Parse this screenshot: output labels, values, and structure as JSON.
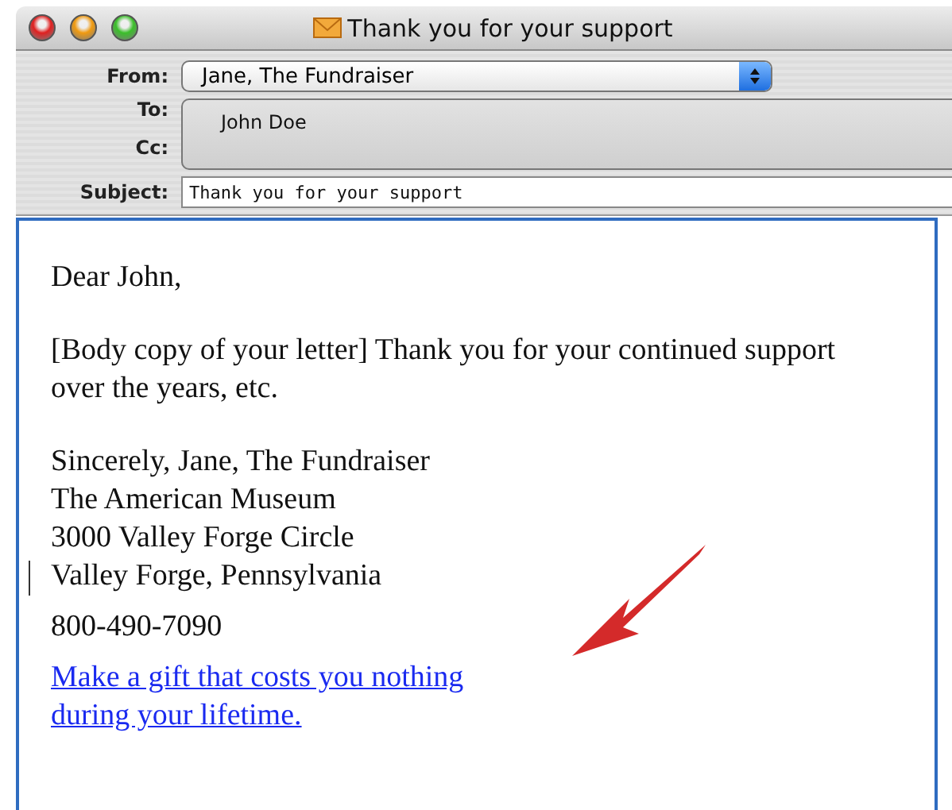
{
  "window": {
    "title": "Thank you for your support"
  },
  "header": {
    "from_label": "From:",
    "from_value": "Jane, The Fundraiser",
    "to_label": "To:",
    "to_recipients": [
      "John Doe"
    ],
    "cc_label": "Cc:",
    "subject_label": "Subject:",
    "subject_value": "Thank you for your support"
  },
  "body": {
    "greeting": "Dear John,",
    "paragraph": "[Body copy of your letter]  Thank you for your continued support over the years, etc.",
    "signature": [
      "Sincerely, Jane, The Fundraiser",
      "The American Museum",
      "3000 Valley Forge Circle",
      "Valley Forge, Pennsylvania"
    ],
    "phone": "800-490-7090",
    "link_lines": [
      "Make a gift that costs you nothing",
      "during your lifetime."
    ]
  }
}
